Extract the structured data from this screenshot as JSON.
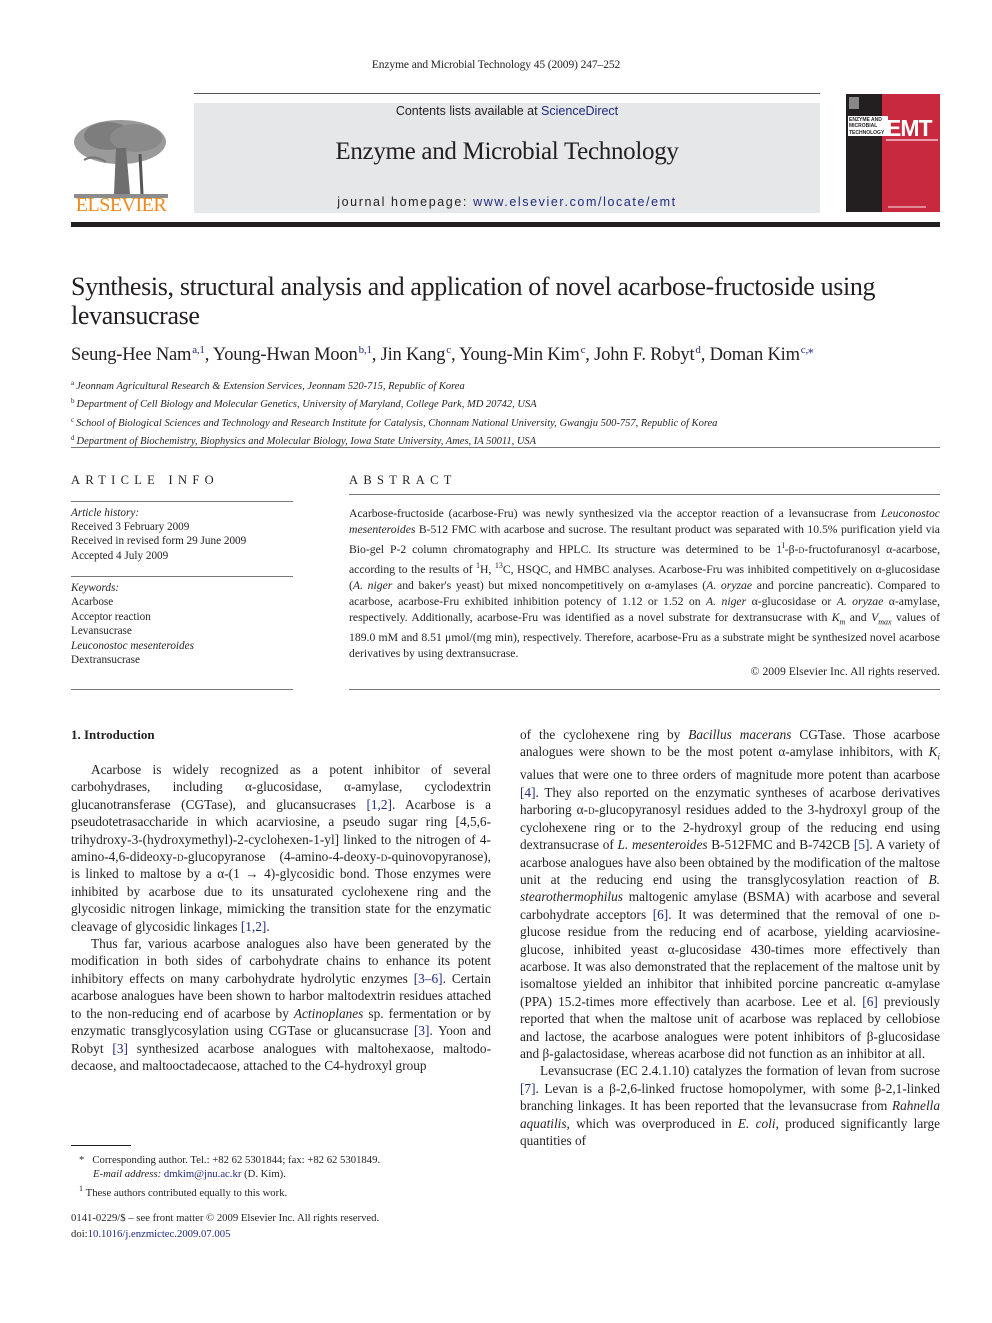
{
  "running_header": "Enzyme and Microbial Technology 45 (2009) 247–252",
  "masthead": {
    "publisher_wordmark": "ELSEVIER",
    "contents_prefix": "Contents lists available at ",
    "contents_link": "ScienceDirect",
    "journal_name": "Enzyme and Microbial Technology",
    "homepage_prefix": "journal homepage: ",
    "homepage_link": "www.elsevier.com/locate/emt",
    "cover": {
      "small_title": "ENZYME AND MICROBIAL TECHNOLOGY",
      "big_title": "EMT",
      "colors": {
        "dark": "#231f20",
        "red": "#c8293f"
      }
    },
    "colors": {
      "banner_bg": "#e6e7e8",
      "elsevier_orange": "#f08a1d",
      "link_blue": "#1f2b7a"
    }
  },
  "article": {
    "title": "Synthesis, structural analysis and application of novel acarbose-fructoside using levansucrase",
    "authors": [
      {
        "name": "Seung-Hee Nam",
        "sup": "a,1"
      },
      {
        "name": "Young-Hwan Moon",
        "sup": "b,1"
      },
      {
        "name": "Jin Kang",
        "sup": "c"
      },
      {
        "name": "Young-Min Kim",
        "sup": "c"
      },
      {
        "name": "John F. Robyt",
        "sup": "d"
      },
      {
        "name": "Doman Kim",
        "sup": "c,⁎"
      }
    ],
    "affiliations": [
      {
        "key": "a",
        "text": "Jeonnam Agricultural Research & Extension Services, Jeonnam 520-715, Republic of Korea"
      },
      {
        "key": "b",
        "text": "Department of Cell Biology and Molecular Genetics, University of Maryland, College Park, MD 20742, USA"
      },
      {
        "key": "c",
        "text": "School of Biological Sciences and Technology and Research Institute for Catalysis, Chonnam National University, Gwangju 500-757, Republic of Korea"
      },
      {
        "key": "d",
        "text": "Department of Biochemistry, Biophysics and Molecular Biology, Iowa State University, Ames, IA 50011, USA"
      }
    ]
  },
  "article_info": {
    "heading": "ARTICLE INFO",
    "history_label": "Article history:",
    "history": [
      "Received 3 February 2009",
      "Received in revised form 29 June 2009",
      "Accepted 4 July 2009"
    ],
    "keywords_label": "Keywords:",
    "keywords": [
      {
        "text": "Acarbose",
        "italic": false
      },
      {
        "text": "Acceptor reaction",
        "italic": false
      },
      {
        "text": "Levansucrase",
        "italic": false
      },
      {
        "text": "Leuconostoc mesenteroides",
        "italic": true
      },
      {
        "text": "Dextransucrase",
        "italic": false
      }
    ]
  },
  "abstract": {
    "heading": "ABSTRACT",
    "s1a": "Acarbose-fructoside (acarbose-Fru) was newly synthesized via the acceptor reaction of a levansucrase from ",
    "s1_species": "Leuconostoc mesenteroides",
    "s1b": " B-512 FMC with acarbose and sucrose. The resultant product was sep­arated with 10.5% purification yield via Bio-gel P-2 column chromatography and HPLC. Its structure was determined to be 1",
    "s1_sup": "I",
    "s1c": "-β-",
    "s1_d": "d",
    "s1d": "-fructofuranosyl α-acarbose, according to the results of ",
    "s1_h_sup": "1",
    "s1e": "H, ",
    "s1_c_sup": "13",
    "s1f": "C, HSQC, and HMBC analyses. Acarbose-Fru was inhibited competitively on α-glucosidase (",
    "sp_aniger": "A. niger",
    "s2a": " and baker's yeast) but mixed noncompetitively on α-amylases (",
    "sp_aoryzae": "A. oryzae",
    "s2b": " and porcine pancreatic). Compared to acarbose, acarbose-Fru exhibited inhibition potency of 1.12 or 1.52 on ",
    "s2c": " α-glucosidase or ",
    "s2d": " α-amylase, respectively. Additionally, acarbose-Fru was identified as a novel substrate for dextransucrase with ",
    "km": "K",
    "km_sub": "m",
    "s3a": " and ",
    "vmax": "V",
    "vmax_sub": "max",
    "s3b": " values of 189.0 mM and 8.51 μmol/(mg min), respectively. Therefore, acarbose-Fru as a substrate might be synthesized novel acarbose derivatives by using dextransucrase.",
    "copyright": "© 2009 Elsevier Inc. All rights reserved."
  },
  "introduction": {
    "heading": "1.  Introduction",
    "p1": {
      "a": "Acarbose is widely recognized as a potent inhibitor of several carbohydrases, including α-glucosidase, α-amylase, cyclodextrin glucanotransferase (CGTase), and glucansucrases ",
      "ref1": "[1,2]",
      "b": ". Acarbose is a pseudotetrasaccharide in which acarviosine, a pseudo sugar ring [4,5,6-trihydroxy-3-(hydroxymethyl)-2-cyclohexen-1-yl] linked to the nitrogen of 4-amino-4,6-dideoxy-",
      "d1": "d",
      "c": "-glucopyranose (4-amino-4-deoxy-",
      "d2": "d",
      "e": "-quinovopyranose), is linked to maltose by a α-(1 → 4)-glycosidic bond. Those enzymes were inhibited by acarbose due to its unsaturated cyclohexene ring and the glycosidic nitrogen linkage, mimicking the transition state for the enzymatic cleavage of glycosidic linkages ",
      "ref2": "[1,2]",
      "f": "."
    },
    "p2": {
      "a": "Thus far, various acarbose analogues also have been generated by the modification in both sides of carbohydrate chains to enhance its potent inhibitory effects on many carbohydrate hydrolytic enzymes ",
      "ref1": "[3–6]",
      "b": ". Certain acarbose analogues have been shown to harbor maltodextrin residues attached to the non-reducing end of acarbose by ",
      "species": "Actinoplanes",
      "c": " sp. fermentation or by enzymatic trans­glycosylation using CGTase or glucansucrase ",
      "ref2": "[3]",
      "d": ". Yoon and Robyt ",
      "ref3": "[3]",
      "e": " synthesized acarbose analogues with maltohexaose, maltodo­decaose, and maltooctadecaose, attached to the C4-hydroxyl group of the cyclohexene ring by ",
      "species2": "Bacillus macerans",
      "f": " CGTase. Those acarbose analogues were shown to be the most potent α-amylase inhibitors, with ",
      "ki": "K",
      "ki_sub": "i",
      "g": " values that were one to three orders of magnitude more potent than acarbose ",
      "ref4": "[4]",
      "h": ". They also reported on the enzymatic syntheses of acarbose derivatives harboring α-",
      "d1": "d",
      "i": "-glucopyranosyl residues added to the 3-hydroxyl group of the cyclohexene ring or to the 2-hydroxyl group of the reducing end using dextransucrase of ",
      "species3": "L. mesenteroides",
      "j": " B-512FMC and B-742CB ",
      "ref5": "[5]",
      "k": ". A variety of acarbose analogues have also been obtained by the modification of the mal­tose unit at the reducing end using the transglycosylation reaction of ",
      "species4": "B. stearothermophilus",
      "l": " maltogenic amylase (BSMA) with acarbose and several carbohydrate acceptors ",
      "ref6": "[6]",
      "m": ". It was determined that the removal of one ",
      "d2": "d",
      "n": "-glucose residue from the reducing end of acar­bose, yielding acarviosine-glucose, inhibited yeast α-glucosidase 430-times more effectively than acarbose. It was also demonstrated that the replacement of the maltose unit by isomaltose yielded an inhibitor that inhibited porcine pancreatic α-amylase (PPA) 15.2-times more effectively than acarbose. Lee et al. ",
      "ref7": "[6]",
      "o": " previously reported that when the maltose unit of acarbose was replaced by cellobiose and lactose, the acarbose analogues were potent inhibitors of β-glucosidase and β-galactosidase, whereas acarbose did not function as an inhibitor at all."
    },
    "p3": {
      "a": "Levansucrase (EC 2.4.1.10) catalyzes the formation of levan from sucrose ",
      "ref1": "[7]",
      "b": ". Levan is a β-2,6-linked fructose homopolymer, with some β-2,1-linked branching linkages. It has been reported that the levansucrase from ",
      "species": "Rahnella aquatilis",
      "c": ", which was over­produced in ",
      "species2": "E. coli",
      "d": ", produced significantly large quantities of"
    }
  },
  "footnotes": {
    "corresponding_marker": "*",
    "corresponding": "Corresponding author. Tel.: +82 62 5301844; fax: +82 62 5301849.",
    "email_label": "E-mail address: ",
    "email": "dmkim@jnu.ac.kr",
    "email_suffix": " (D. Kim).",
    "equal_marker": "1",
    "equal": "These authors contributed equally to this work.",
    "front_matter": "0141-0229/$ – see front matter © 2009 Elsevier Inc. All rights reserved.",
    "doi_label": "doi:",
    "doi": "10.1016/j.enzmictec.2009.07.005"
  }
}
